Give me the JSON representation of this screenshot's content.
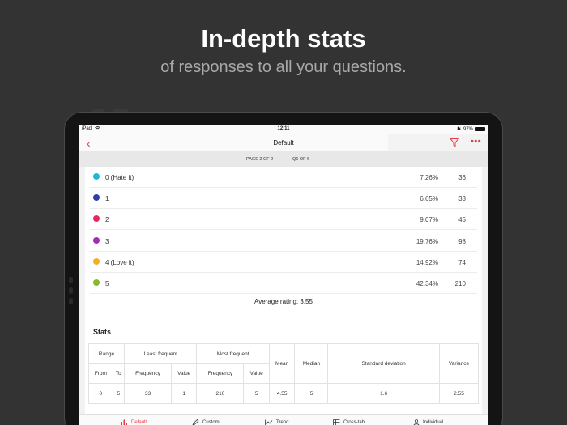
{
  "promo": {
    "headline": "In-depth stats",
    "subline": "of responses to all your questions."
  },
  "statusbar": {
    "device": "iPad",
    "time": "12:11",
    "battery": "97%"
  },
  "navbar": {
    "title": "Default"
  },
  "pager": {
    "page": "PAGE 2 OF 2",
    "question": "Q6 OF 6"
  },
  "responses": [
    {
      "label": "0 (Hate it)",
      "percent": "7.26%",
      "count": "36",
      "color": "#1fb8d4"
    },
    {
      "label": "1",
      "percent": "6.65%",
      "count": "33",
      "color": "#2f3fa3"
    },
    {
      "label": "2",
      "percent": "9.07%",
      "count": "45",
      "color": "#e8265e"
    },
    {
      "label": "3",
      "percent": "19.76%",
      "count": "98",
      "color": "#9d2fb0"
    },
    {
      "label": "4 (Love it)",
      "percent": "14.92%",
      "count": "74",
      "color": "#f2b020"
    },
    {
      "label": "5",
      "percent": "42.34%",
      "count": "210",
      "color": "#86b82d"
    }
  ],
  "average": "Average rating: 3.55",
  "stats": {
    "title": "Stats",
    "headers": {
      "range": "Range",
      "least": "Least frequent",
      "most": "Most frequent",
      "mean": "Mean",
      "median": "Median",
      "stddev": "Standard deviation",
      "variance": "Variance",
      "from": "From",
      "to": "To",
      "frequency": "Frequency",
      "value": "Value"
    },
    "values": {
      "from": "0",
      "to": "5",
      "least_freq": "33",
      "least_val": "1",
      "most_freq": "210",
      "most_val": "5",
      "mean": "4.55",
      "median": "5",
      "stddev": "1.6",
      "variance": "2.55"
    }
  },
  "tabs": [
    {
      "label": "Default",
      "icon": "bar-chart-icon"
    },
    {
      "label": "Custom",
      "icon": "pencil-icon"
    },
    {
      "label": "Trend",
      "icon": "trend-icon"
    },
    {
      "label": "Cross-tab",
      "icon": "crosstab-icon"
    },
    {
      "label": "Individual",
      "icon": "person-icon"
    }
  ],
  "colors": {
    "accent": "#e63946"
  }
}
